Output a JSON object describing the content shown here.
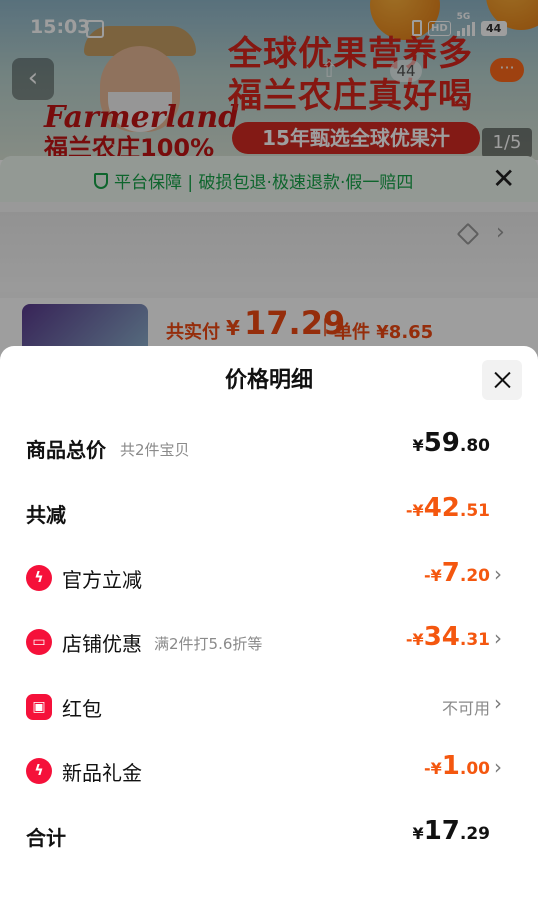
{
  "status_bar": {
    "time": "15:03",
    "hd": "HD",
    "network": "5G",
    "battery": "44"
  },
  "banner": {
    "brand_en": "Farmerland",
    "brand_cn": "福兰农庄100%",
    "headline_1": "全球优果营养多",
    "headline_2": "福兰农庄真好喝",
    "pill": "15年甄选全球优果汁",
    "page_indicator": "1/5",
    "cart_count": "44",
    "more": "···"
  },
  "background_sheet": {
    "guarantee": "平台保障 | 破损包退·极速退款·假一赔四",
    "paid_label": "共实付",
    "paid_yen": "¥",
    "paid_amount": "17.29",
    "paid_sep": "|",
    "unit_price": "单件 ¥8.65"
  },
  "sheet": {
    "title": "价格明细",
    "rows": [
      {
        "label": "商品总价",
        "sub": "共2件宝贝",
        "yen": "¥",
        "int": "59",
        "dec": ".80"
      },
      {
        "label": "共减",
        "yen": "-¥",
        "int": "42",
        "dec": ".51"
      },
      {
        "label": "官方立减",
        "yen": "-¥",
        "int": "7",
        "dec": ".20"
      },
      {
        "label": "店铺优惠",
        "sub": "满2件打5.6折等",
        "yen": "-¥",
        "int": "34",
        "dec": ".31"
      },
      {
        "label": "红包",
        "value": "不可用"
      },
      {
        "label": "新品礼金",
        "yen": "-¥",
        "int": "1",
        "dec": ".00"
      },
      {
        "label": "合计",
        "yen": "¥",
        "int": "17",
        "dec": ".29"
      }
    ]
  },
  "colors": {
    "accent_orange": "#f4570f",
    "icon_red": "#f5113a",
    "guarantee_green": "#17a34a"
  }
}
